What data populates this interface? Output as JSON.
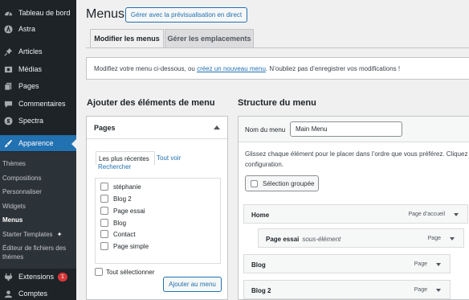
{
  "sidebar": {
    "items": [
      {
        "label": "Tableau de bord",
        "icon": "dashboard-icon"
      },
      {
        "label": "Astra",
        "icon": "astra-icon"
      },
      {
        "label": "Articles",
        "icon": "pin-icon"
      },
      {
        "label": "Médias",
        "icon": "media-icon"
      },
      {
        "label": "Pages",
        "icon": "pages-icon"
      },
      {
        "label": "Commentaires",
        "icon": "comments-icon"
      },
      {
        "label": "Spectra",
        "icon": "spectra-icon"
      },
      {
        "label": "Apparence",
        "icon": "brush-icon"
      },
      {
        "label": "Extensions",
        "icon": "plugins-icon",
        "badge": "1"
      },
      {
        "label": "Comptes",
        "icon": "users-icon"
      }
    ],
    "submenu": [
      "Thèmes",
      "Compositions",
      "Personnaliser",
      "Widgets",
      "Menus",
      "Starter Templates",
      "Éditeur de fichiers des thèmes"
    ],
    "accent": "#2271b1"
  },
  "header": {
    "title": "Menus",
    "preview_button": "Gérer avec la prévisualisation en direct"
  },
  "tabs": [
    "Modifier les menus",
    "Gérer les emplacements"
  ],
  "notice": {
    "before": "Modifiez votre menu ci-dessous, ou ",
    "link": "créez un nouveau menu",
    "after": ". N’oubliez pas d’enregistrer vos modifications !"
  },
  "add_items": {
    "heading": "Ajouter des éléments de menu",
    "panel_title": "Pages",
    "tabs": [
      "Les plus récentes",
      "Tout voir",
      "Rechercher"
    ],
    "pages": [
      "stéphanie",
      "Blog 2",
      "Page essai",
      "Blog",
      "Contact",
      "Page simple"
    ],
    "select_all": "Tout sélectionner",
    "add_button": "Ajouter au menu"
  },
  "structure": {
    "heading": "Structure du menu",
    "name_label": "Nom du menu",
    "name_value": "Main Menu",
    "description": "Glissez chaque élément pour le placer dans l’ordre que vous préférez. Cliquez configuration.",
    "bulk_select": "Sélection groupée",
    "items": [
      {
        "name": "Home",
        "sub": "",
        "type": "Page d’accueil"
      },
      {
        "name": "Page essai",
        "sub": "sous-élément",
        "type": "Page"
      },
      {
        "name": "Blog",
        "sub": "",
        "type": "Page"
      },
      {
        "name": "Blog 2",
        "sub": "",
        "type": "Page"
      }
    ]
  }
}
